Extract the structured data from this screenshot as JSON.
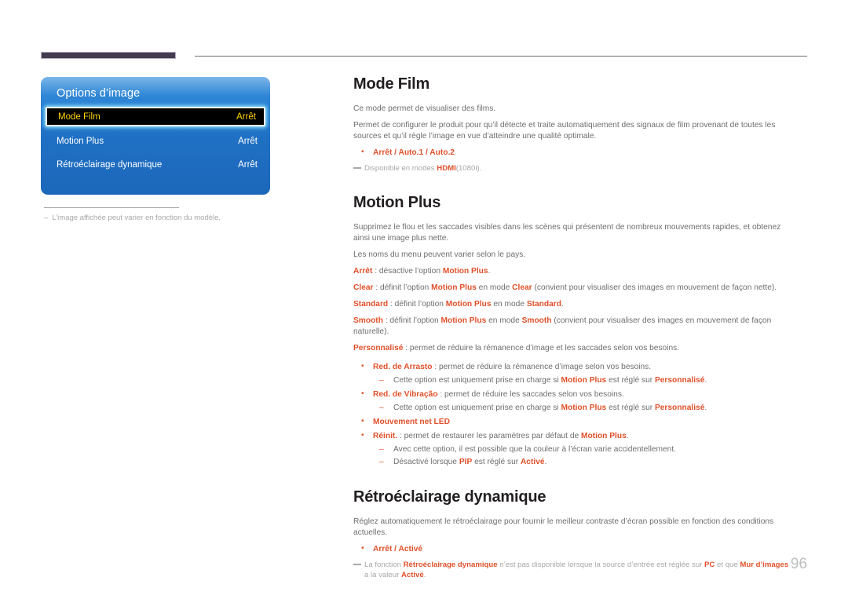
{
  "page": {
    "number": "96"
  },
  "osd": {
    "title": "Options d’image",
    "rows": [
      {
        "label": "Mode Film",
        "value": "Arrêt",
        "selected": true
      },
      {
        "label": "Motion Plus",
        "value": "Arrêt",
        "selected": false
      },
      {
        "label": "Rétroéclairage dynamique",
        "value": "Arrêt",
        "selected": false
      }
    ],
    "note": "L’image affichée peut varier en fonction du modèle.",
    "note_dash": "–"
  },
  "sections": {
    "mode_film": {
      "title": "Mode Film",
      "p1": "Ce mode permet de visualiser des films.",
      "p2": "Permet de configurer le produit pour qu’il détecte et traite automatiquement des signaux de film provenant de toutes les sources et qu’il règle l’image en vue d’atteindre une qualité optimale.",
      "options": "Arrêt / Auto.1 / Auto.2",
      "note_pre": "Disponible en modes ",
      "note_bold": "HDMI",
      "note_post": "(1080i)."
    },
    "motion_plus": {
      "title": "Motion Plus",
      "p1": "Supprimez le flou et les saccades visibles dans les scènes qui présentent de nombreux mouvements rapides, et obtenez ainsi une image plus nette.",
      "p2": "Les noms du menu peuvent varier selon le pays.",
      "arret_term": "Arrêt",
      "arret_desc_1": " : désactive l’option ",
      "arret_term2": "Motion Plus",
      "arret_desc_2": ".",
      "clear_term": "Clear",
      "clear_d1": " : définit l’option ",
      "clear_t2": "Motion Plus",
      "clear_d2": " en mode ",
      "clear_t3": "Clear",
      "clear_d3": " (convient pour visualiser des images en mouvement de façon nette).",
      "standard_term": "Standard",
      "standard_d1": " : définit l’option ",
      "standard_t2": "Motion Plus",
      "standard_d2": " en mode ",
      "standard_t3": "Standard",
      "standard_d3": ".",
      "smooth_term": "Smooth",
      "smooth_d1": " : définit l’option ",
      "smooth_t2": "Motion Plus",
      "smooth_d2": " en mode ",
      "smooth_t3": "Smooth",
      "smooth_d3": " (convient pour visualiser des images en mouvement de façon naturelle).",
      "perso_term": "Personnalisé",
      "perso_desc": " : permet de réduire la rémanence d’image et les saccades selon vos besoins.",
      "arrasto_term": "Red. de Arrasto",
      "arrasto_desc": " : permet de réduire la rémanence d’image selon vos besoins.",
      "arrasto_sub_pre": "Cette option est uniquement prise en charge si ",
      "arrasto_sub_t1": "Motion Plus",
      "arrasto_sub_mid": " est réglé sur ",
      "arrasto_sub_t2": "Personnalisé",
      "arrasto_sub_end": ".",
      "vibracao_term": "Red. de Vibração",
      "vibracao_desc": " : permet de réduire les saccades selon vos besoins.",
      "vibracao_sub_pre": "Cette option est uniquement prise en charge si ",
      "vibracao_sub_t1": "Motion Plus",
      "vibracao_sub_mid": " est réglé sur ",
      "vibracao_sub_t2": "Personnalisé",
      "vibracao_sub_end": ".",
      "led_term": "Mouvement net LED",
      "reinit_term": "Réinit.",
      "reinit_d1": " : permet de restaurer les paramètres par défaut de ",
      "reinit_t2": "Motion Plus",
      "reinit_d2": ".",
      "reinit_sub1": "Avec cette option, il est possible que la couleur à l’écran varie accidentellement.",
      "reinit_sub2_pre": "Désactivé lorsque ",
      "reinit_sub2_t1": "PIP",
      "reinit_sub2_mid": " est réglé sur ",
      "reinit_sub2_t2": "Activé",
      "reinit_sub2_end": "."
    },
    "retro": {
      "title": "Rétroéclairage dynamique",
      "p1": "Réglez automatiquement le rétroéclairage pour fournir le meilleur contraste d’écran possible en fonction des conditions actuelles.",
      "options": "Arrêt / Activé",
      "note_pre": "La fonction ",
      "note_t1": "Rétroéclairage dynamique",
      "note_mid": " n’est pas disponible lorsque la source d’entrée est réglée sur ",
      "note_t2": "PC",
      "note_mid2": " et que ",
      "note_t3": "Mur d’images",
      "note_mid3": " a la valeur ",
      "note_t4": "Activé",
      "note_end": "."
    }
  },
  "colors": {
    "accent": "#e0512b",
    "osd_selected_text": "#ffd300",
    "header_block": "#463c52"
  }
}
